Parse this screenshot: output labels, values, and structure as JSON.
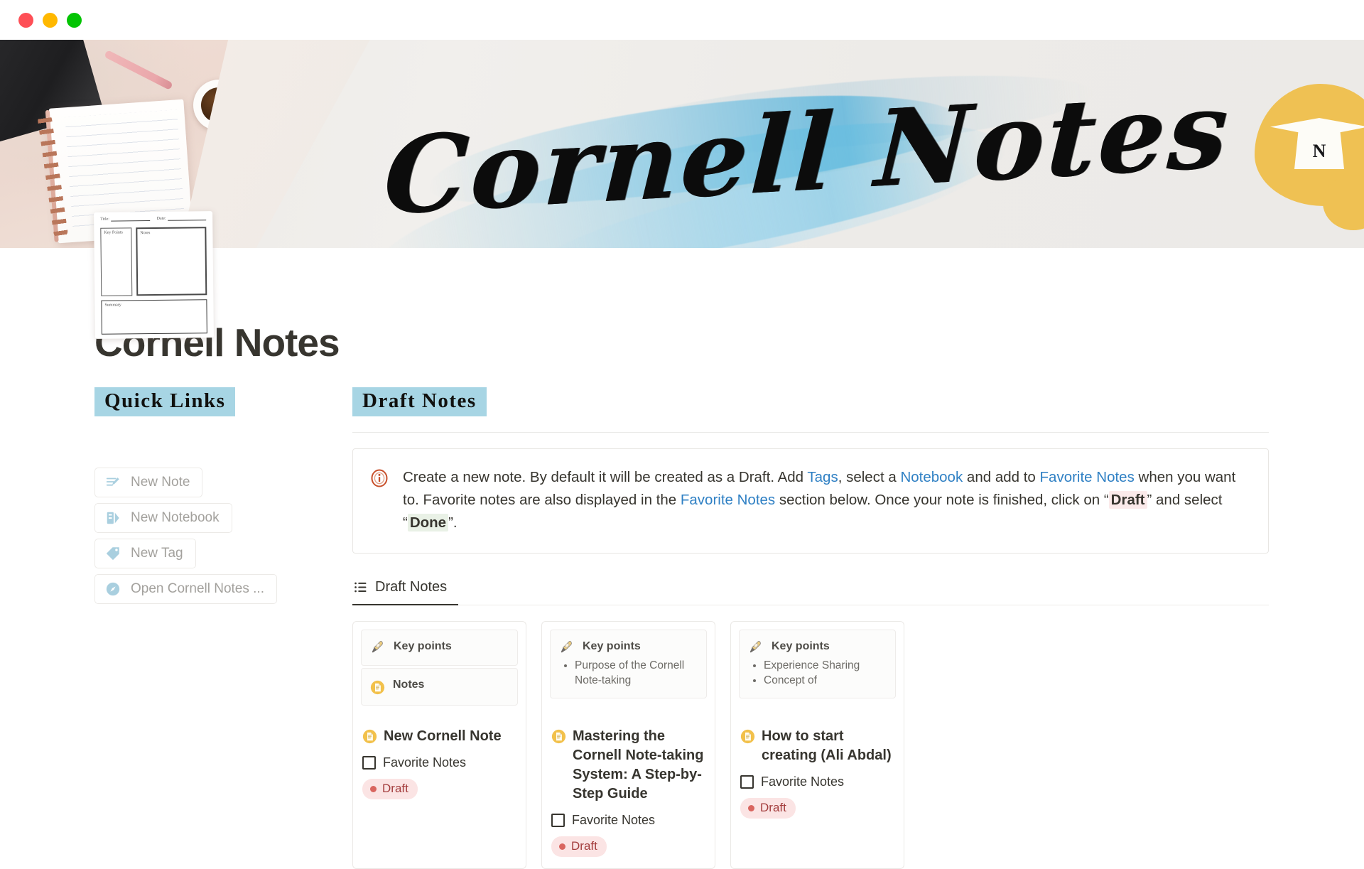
{
  "window": {
    "controls": [
      "close",
      "minimize",
      "maximize"
    ]
  },
  "banner": {
    "title": "Cornell Notes",
    "badge_letter": "N",
    "template_sheet": {
      "title_label": "Title:",
      "date_label": "Date:",
      "key_points_label": "Key Points",
      "notes_label": "Notes",
      "summary_label": "Summary"
    }
  },
  "page": {
    "title": "Cornell Notes"
  },
  "quick_links": {
    "heading": "Quick Links",
    "items": [
      {
        "label": "New Note",
        "icon": "note-edit-icon"
      },
      {
        "label": "New Notebook",
        "icon": "notebook-icon"
      },
      {
        "label": "New Tag",
        "icon": "tag-icon"
      },
      {
        "label": "Open Cornell Notes ...",
        "icon": "compass-icon"
      }
    ]
  },
  "draft_notes": {
    "heading": "Draft Notes",
    "callout": {
      "icon": "info-icon",
      "segments": [
        {
          "text": "Create a new note. By default it will be created as a Draft. Add ",
          "style": "plain"
        },
        {
          "text": "Tags",
          "style": "link"
        },
        {
          "text": ", select a ",
          "style": "plain"
        },
        {
          "text": "Notebook",
          "style": "link"
        },
        {
          "text": " and add to ",
          "style": "plain"
        },
        {
          "text": "Favorite Notes",
          "style": "link"
        },
        {
          "text": " when you want to. Favorite notes are also displayed in the ",
          "style": "plain"
        },
        {
          "text": "Favorite Notes",
          "style": "link"
        },
        {
          "text": " section below. Once your note is finished, click on “",
          "style": "plain"
        },
        {
          "text": "Draft",
          "style": "chip-draft"
        },
        {
          "text": "” and select “",
          "style": "plain"
        },
        {
          "text": "Done",
          "style": "chip-done"
        },
        {
          "text": "”.",
          "style": "plain"
        }
      ]
    },
    "tabs": [
      {
        "label": "Draft Notes",
        "icon": "list-icon",
        "active": true
      }
    ],
    "cards": [
      {
        "preview_blocks": [
          {
            "label": "Key points",
            "icon": "highlighter-icon",
            "bullets": []
          },
          {
            "label": "Notes",
            "icon": "document-icon",
            "bullets": []
          }
        ],
        "title": "New Cornell Note",
        "title_icon": "document-icon",
        "favorite_label": "Favorite Notes",
        "favorite_checked": false,
        "status": "Draft",
        "status_color": "#d9655f"
      },
      {
        "preview_blocks": [
          {
            "label": "Key points",
            "icon": "highlighter-icon",
            "bullets": [
              "Purpose of the Cornell Note-taking"
            ]
          }
        ],
        "title": "Mastering the Cornell Note-taking System: A Step-by-Step Guide",
        "title_icon": "document-icon",
        "favorite_label": "Favorite Notes",
        "favorite_checked": false,
        "status": "Draft",
        "status_color": "#d9655f"
      },
      {
        "preview_blocks": [
          {
            "label": "Key points",
            "icon": "highlighter-icon",
            "bullets": [
              "Experience Sharing",
              "Concept of"
            ]
          }
        ],
        "title": "How to start creating (Ali Abdal)",
        "title_icon": "document-icon",
        "favorite_label": "Favorite Notes",
        "favorite_checked": false,
        "status": "Draft",
        "status_color": "#d9655f"
      }
    ]
  },
  "colors": {
    "accent_highlight": "#a7d5e4",
    "link": "#2f80c4",
    "text": "#37352f",
    "draft_pill_bg": "#fbe4e4",
    "draft_pill_text": "#a33c3c",
    "badge_gold": "#efc153"
  }
}
